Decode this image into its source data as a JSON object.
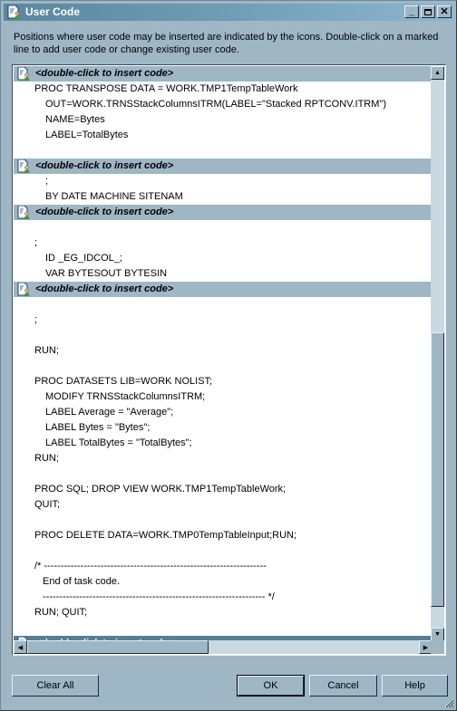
{
  "window": {
    "title": "User Code",
    "icon": "user-code-icon",
    "controls": {
      "minimize": "minimize-icon",
      "maximize": "maximize-icon",
      "close": "close-icon"
    }
  },
  "instructions": "Positions where user code may be inserted are indicated by the icons. Double-click on a marked line to add user code or change existing user code.",
  "code_lines": [
    {
      "type": "marker",
      "text": "<double-click to insert code>",
      "selected": false
    },
    {
      "type": "code",
      "indent": 0,
      "text": "PROC TRANSPOSE DATA = WORK.TMP1TempTableWork"
    },
    {
      "type": "code",
      "indent": 1,
      "text": "OUT=WORK.TRNSStackColumnsITRM(LABEL=\"Stacked RPTCONV.ITRM\")"
    },
    {
      "type": "code",
      "indent": 1,
      "text": "NAME=Bytes"
    },
    {
      "type": "code",
      "indent": 1,
      "text": "LABEL=TotalBytes"
    },
    {
      "type": "blank"
    },
    {
      "type": "marker",
      "text": "<double-click to insert code>",
      "selected": false
    },
    {
      "type": "code",
      "indent": 1,
      "text": ";"
    },
    {
      "type": "code",
      "indent": 1,
      "text": "BY DATE MACHINE SITENAM"
    },
    {
      "type": "marker",
      "text": "<double-click to insert code>",
      "selected": false
    },
    {
      "type": "blank"
    },
    {
      "type": "code",
      "indent": 0,
      "text": ";"
    },
    {
      "type": "code",
      "indent": 1,
      "text": "ID _EG_IDCOL_;"
    },
    {
      "type": "code",
      "indent": 1,
      "text": "VAR BYTESOUT BYTESIN"
    },
    {
      "type": "marker",
      "text": "<double-click to insert code>",
      "selected": false
    },
    {
      "type": "blank"
    },
    {
      "type": "code",
      "indent": 0,
      "text": ";"
    },
    {
      "type": "blank"
    },
    {
      "type": "code",
      "indent": 0,
      "text": "RUN;"
    },
    {
      "type": "blank"
    },
    {
      "type": "code",
      "indent": 0,
      "text": "PROC DATASETS LIB=WORK NOLIST;"
    },
    {
      "type": "code",
      "indent": 1,
      "text": "MODIFY TRNSStackColumnsITRM;"
    },
    {
      "type": "code",
      "indent": 1,
      "text": "LABEL Average = \"Average\";"
    },
    {
      "type": "code",
      "indent": 1,
      "text": "LABEL Bytes = \"Bytes\";"
    },
    {
      "type": "code",
      "indent": 1,
      "text": "LABEL TotalBytes = \"TotalBytes\";"
    },
    {
      "type": "code",
      "indent": 0,
      "text": "RUN;"
    },
    {
      "type": "blank"
    },
    {
      "type": "code",
      "indent": 0,
      "text": "PROC SQL; DROP VIEW WORK.TMP1TempTableWork;"
    },
    {
      "type": "code",
      "indent": 0,
      "text": "QUIT;"
    },
    {
      "type": "blank"
    },
    {
      "type": "code",
      "indent": 0,
      "text": "PROC DELETE DATA=WORK.TMP0TempTableInput;RUN;"
    },
    {
      "type": "blank"
    },
    {
      "type": "code",
      "indent": 0,
      "text": "/* -------------------------------------------------------------------"
    },
    {
      "type": "code",
      "indent": 2,
      "text": "End of task code."
    },
    {
      "type": "code",
      "indent": 2,
      "text": "------------------------------------------------------------------- */"
    },
    {
      "type": "code",
      "indent": 0,
      "text": "RUN; QUIT;"
    },
    {
      "type": "blank"
    },
    {
      "type": "marker",
      "text": "<double-click to insert code>",
      "selected": true
    }
  ],
  "scroll": {
    "vertical_position_fraction": 0.52,
    "horizontal_position_fraction": 0.0
  },
  "buttons": {
    "clear_all": "Clear All",
    "ok": "OK",
    "cancel": "Cancel",
    "help": "Help"
  },
  "colors": {
    "window_bg": "#9fb6c5",
    "title_gradient_start": "#5a879f",
    "title_gradient_end": "#8cb6d1",
    "marker_bg": "#9fb6c5",
    "marker_selected_bg": "#557f98"
  }
}
